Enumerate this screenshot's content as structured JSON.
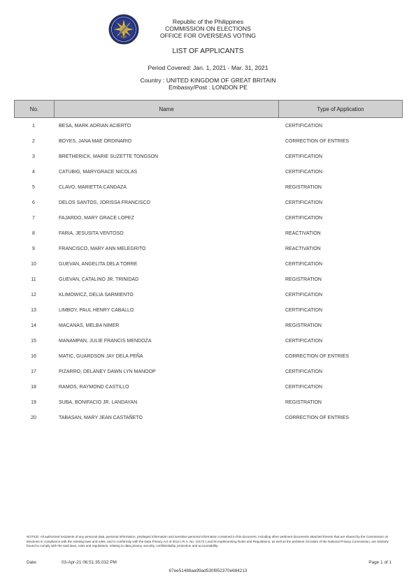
{
  "header": {
    "line1": "Republic of the Philippines",
    "line2": "COMMISSION ON ELECTIONS",
    "line3": "OFFICE FOR OVERSEAS VOTING",
    "title": "LIST OF APPLICANTS",
    "period": "Period Covered: Jan. 1, 2021 - Mar. 31, 2021",
    "country": "Country : UNITED KINGDOM OF GREAT BRITAIN",
    "post": "Embassy/Post :   LONDON PE",
    "logo_icon": "comelec-seal-icon"
  },
  "table": {
    "columns": [
      "No.",
      "Name",
      "Type of Application"
    ],
    "rows": [
      {
        "no": "1",
        "name": "BESA, MARK ADRIAN ACIERTO",
        "type": "CERTIFICATION"
      },
      {
        "no": "2",
        "name": "BOYES, JANA MAE ORDINARIO",
        "type": "CORRECTION OF ENTRIES"
      },
      {
        "no": "3",
        "name": "BRETHERICK, MARIE SUZETTE TONGSON",
        "type": "CERTIFICATION"
      },
      {
        "no": "4",
        "name": "CATUBIG, MARYGRACE NICOLAS",
        "type": "CERTIFICATION"
      },
      {
        "no": "5",
        "name": "CLAVO, MARIETTA CANDAZA",
        "type": "REGISTRATION"
      },
      {
        "no": "6",
        "name": "DELOS SANTOS, JORISSA FRANCISCO",
        "type": "CERTIFICATION"
      },
      {
        "no": "7",
        "name": "FAJARDO, MARY GRACE LOPEZ",
        "type": "CERTIFICATION"
      },
      {
        "no": "8",
        "name": "FARIA, JESUSITA VENTOSO",
        "type": "REACTIVATION"
      },
      {
        "no": "9",
        "name": "FRANCISCO, MARY ANN MELEGRITO",
        "type": "REACTIVATION"
      },
      {
        "no": "10",
        "name": "GUEVAN, ANGELITA DELA TORRE",
        "type": "CERTIFICATION"
      },
      {
        "no": "11",
        "name": "GUEVAN, CATALINO JR. TRINIDAD",
        "type": "REGISTRATION"
      },
      {
        "no": "12",
        "name": "KLIMOWICZ, DELIA SARMIENTO",
        "type": "CERTIFICATION"
      },
      {
        "no": "13",
        "name": "LIMBOY, PAUL HENRY CABALLO",
        "type": "CERTIFICATION"
      },
      {
        "no": "14",
        "name": "MACANAS, MELBA NIMER",
        "type": "REGISTRATION"
      },
      {
        "no": "15",
        "name": "MANAMPAN, JULIE FRANCIS MENDOZA",
        "type": "CERTIFICATION"
      },
      {
        "no": "16",
        "name": "MATIC, GUARDSON JAY DELA PEÑA",
        "type": "CORRECTION OF ENTRIES"
      },
      {
        "no": "17",
        "name": "PIZARRO, DELANEY DAWN LYN MANOOP",
        "type": "CERTIFICATION"
      },
      {
        "no": "18",
        "name": "RAMOS, RAYMOND CASTILLO",
        "type": "CERTIFICATION"
      },
      {
        "no": "19",
        "name": "SUBA, BONIFACIO JR. LANDAYAN",
        "type": "REGISTRATION"
      },
      {
        "no": "20",
        "name": "TABASAN, MARY JEAN CASTAÑETO",
        "type": "CORRECTION OF ENTRIES"
      }
    ]
  },
  "footer": {
    "notice": "NOTICE: All authorized recipients of any personal data, personal information, privileged information and sensitive personal information contained in this document, including other pertinent documents attached thereto that are shared by the Commission on Elections in compliance with the existing laws and rules, and in conformity with the Data Privacy Act of 2012 ( R.A. No. 10173 ) and its implementing Rules and Regulations, as well as the pertinent Circulars of the National Privacy Commission, are similarly bound to comply with the said laws, rules and regulations, relating to data privacy, security, confidentiality, protection and accountability.",
    "date_label": "Date:",
    "date_value": "03-Apr-21 06:51:35.032 PM",
    "page": "Page 1 of 1",
    "hash": "67ee51488aa99ad530f852370e684213"
  }
}
